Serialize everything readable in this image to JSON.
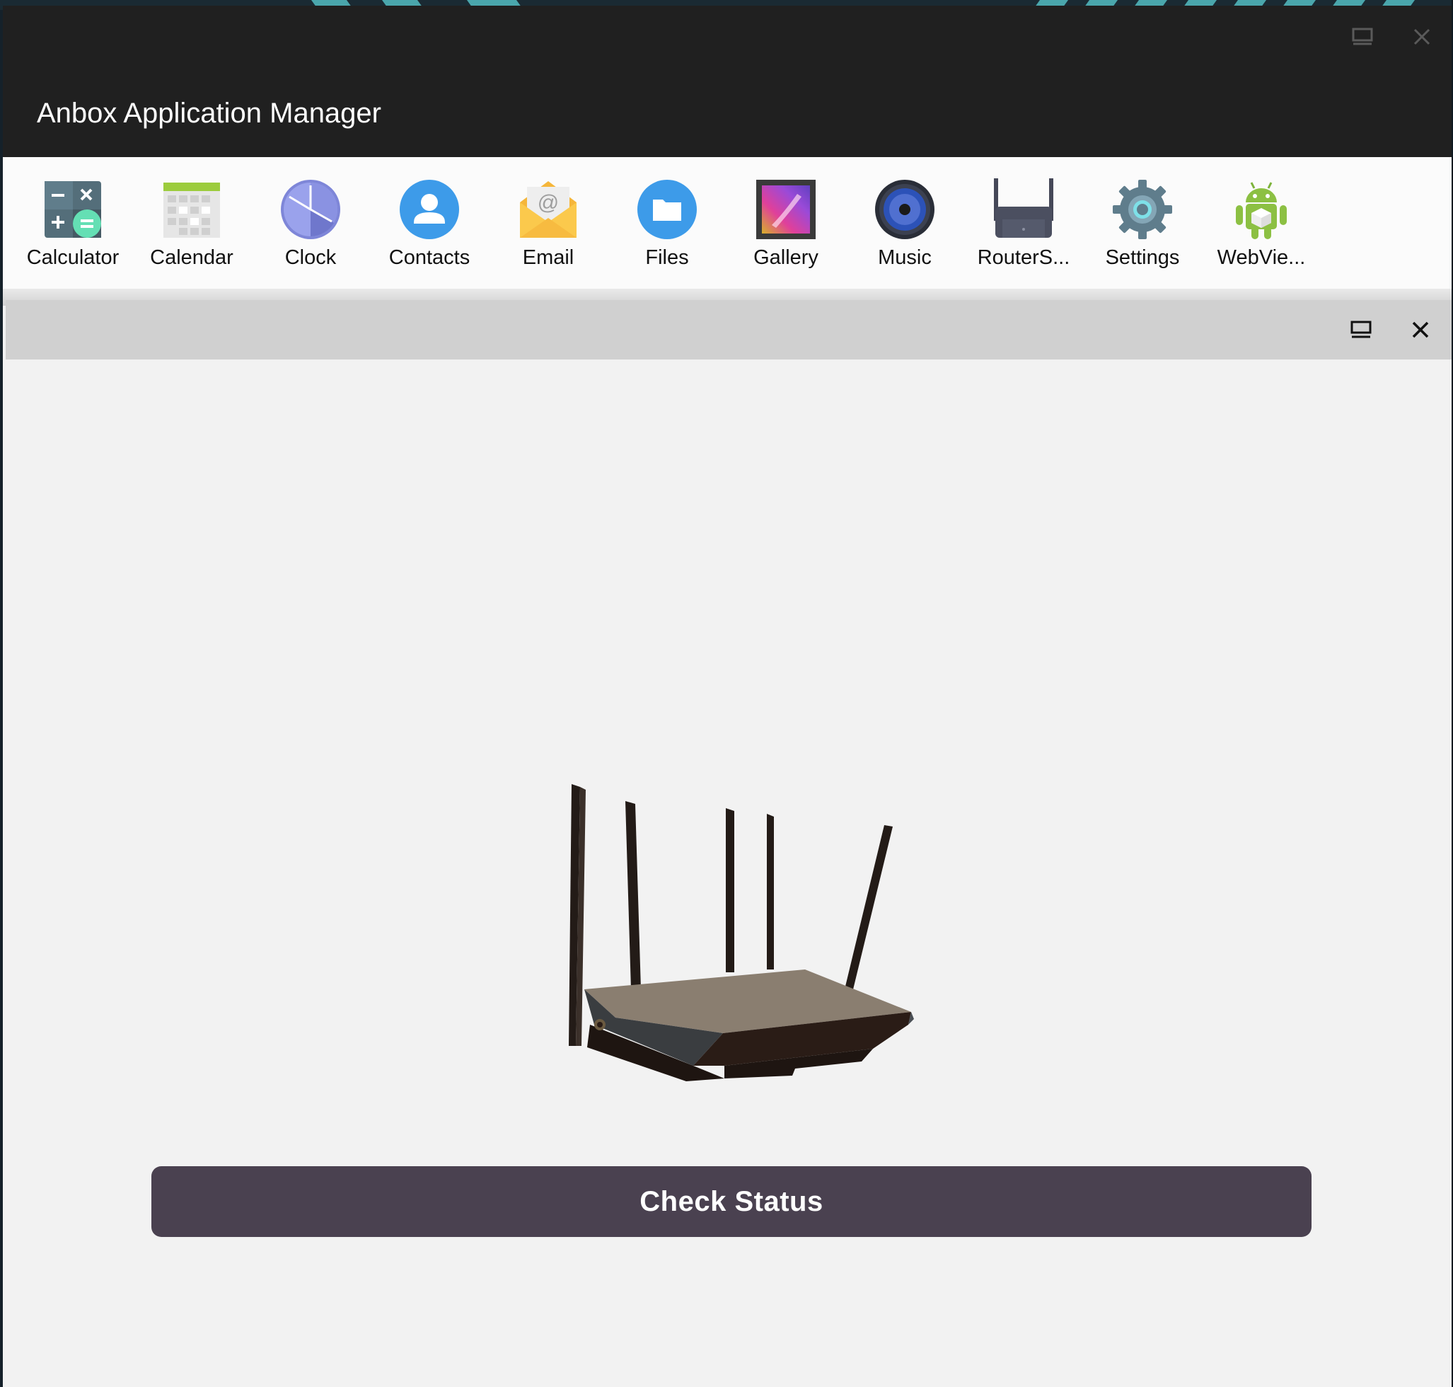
{
  "window": {
    "title": "Anbox Application Manager",
    "maximize_icon": "maximize-icon",
    "close_icon": "close-icon"
  },
  "launcher": {
    "apps": [
      {
        "label": "Calculator",
        "icon": "calculator-icon"
      },
      {
        "label": "Calendar",
        "icon": "calendar-icon"
      },
      {
        "label": "Clock",
        "icon": "clock-icon"
      },
      {
        "label": "Contacts",
        "icon": "contacts-icon"
      },
      {
        "label": "Email",
        "icon": "email-icon"
      },
      {
        "label": "Files",
        "icon": "files-icon"
      },
      {
        "label": "Gallery",
        "icon": "gallery-icon"
      },
      {
        "label": "Music",
        "icon": "music-icon"
      },
      {
        "label": "RouterS...",
        "icon": "router-app-icon"
      },
      {
        "label": "Settings",
        "icon": "settings-icon"
      },
      {
        "label": "WebVie...",
        "icon": "android-webview-icon"
      }
    ]
  },
  "app_window": {
    "maximize_icon": "maximize-icon",
    "close_icon": "close-icon",
    "image": "router-image",
    "button_label": "Check Status"
  },
  "colors": {
    "titlebar": "#202020",
    "button": "#4a4150",
    "app_bar": "#d0d0d0",
    "background": "#f2f2f2"
  }
}
